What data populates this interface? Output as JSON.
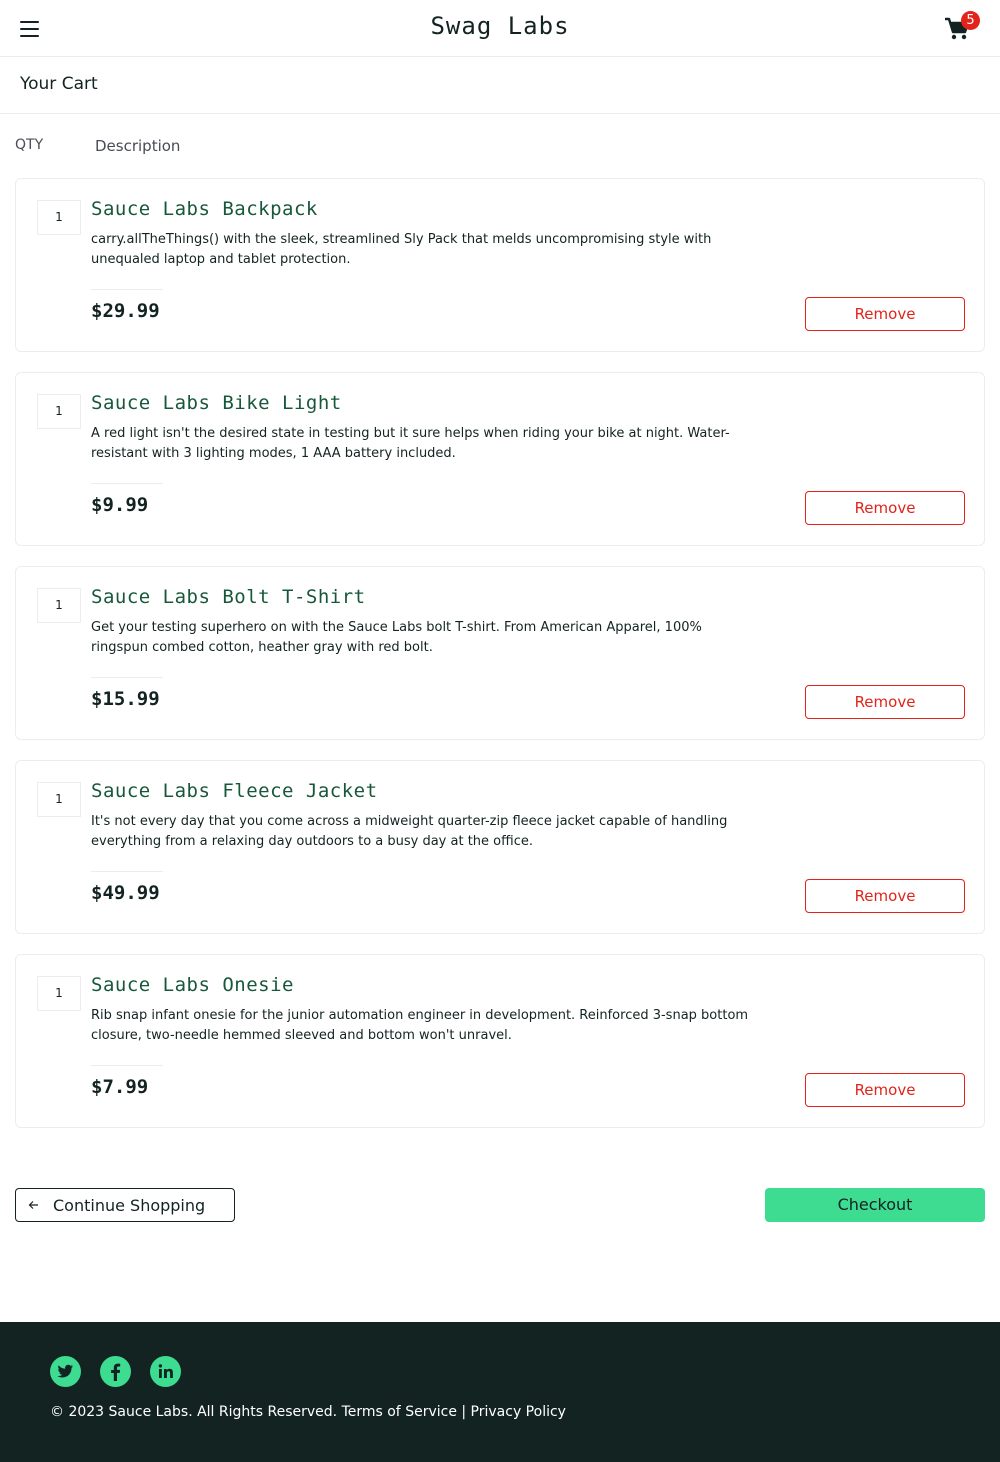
{
  "header": {
    "app_title": "Swag Labs",
    "cart_count": "5"
  },
  "page": {
    "title": "Your Cart"
  },
  "columns": {
    "qty": "QTY",
    "description": "Description"
  },
  "items": [
    {
      "qty": "1",
      "name": "Sauce Labs Backpack",
      "description": "carry.allTheThings() with the sleek, streamlined Sly Pack that melds uncompromising style with unequaled laptop and tablet protection.",
      "price": "$29.99",
      "remove_label": "Remove"
    },
    {
      "qty": "1",
      "name": "Sauce Labs Bike Light",
      "description": "A red light isn't the desired state in testing but it sure helps when riding your bike at night. Water-resistant with 3 lighting modes, 1 AAA battery included.",
      "price": "$9.99",
      "remove_label": "Remove"
    },
    {
      "qty": "1",
      "name": "Sauce Labs Bolt T-Shirt",
      "description": "Get your testing superhero on with the Sauce Labs bolt T-shirt. From American Apparel, 100% ringspun combed cotton, heather gray with red bolt.",
      "price": "$15.99",
      "remove_label": "Remove"
    },
    {
      "qty": "1",
      "name": "Sauce Labs Fleece Jacket",
      "description": "It's not every day that you come across a midweight quarter-zip fleece jacket capable of handling everything from a relaxing day outdoors to a busy day at the office.",
      "price": "$49.99",
      "remove_label": "Remove"
    },
    {
      "qty": "1",
      "name": "Sauce Labs Onesie",
      "description": "Rib snap infant onesie for the junior automation engineer in development. Reinforced 3-snap bottom closure, two-needle hemmed sleeved and bottom won't unravel.",
      "price": "$7.99",
      "remove_label": "Remove"
    }
  ],
  "actions": {
    "continue_label": "Continue Shopping",
    "checkout_label": "Checkout"
  },
  "footer": {
    "social": [
      "twitter-icon",
      "facebook-icon",
      "linkedin-icon"
    ],
    "copyright": "© 2023 Sauce Labs. All Rights Reserved. Terms of Service | Privacy Policy"
  },
  "colors": {
    "accent": "#3ddc91",
    "danger": "#e2231a",
    "product_name": "#18583a",
    "footer_bg": "#132322"
  }
}
